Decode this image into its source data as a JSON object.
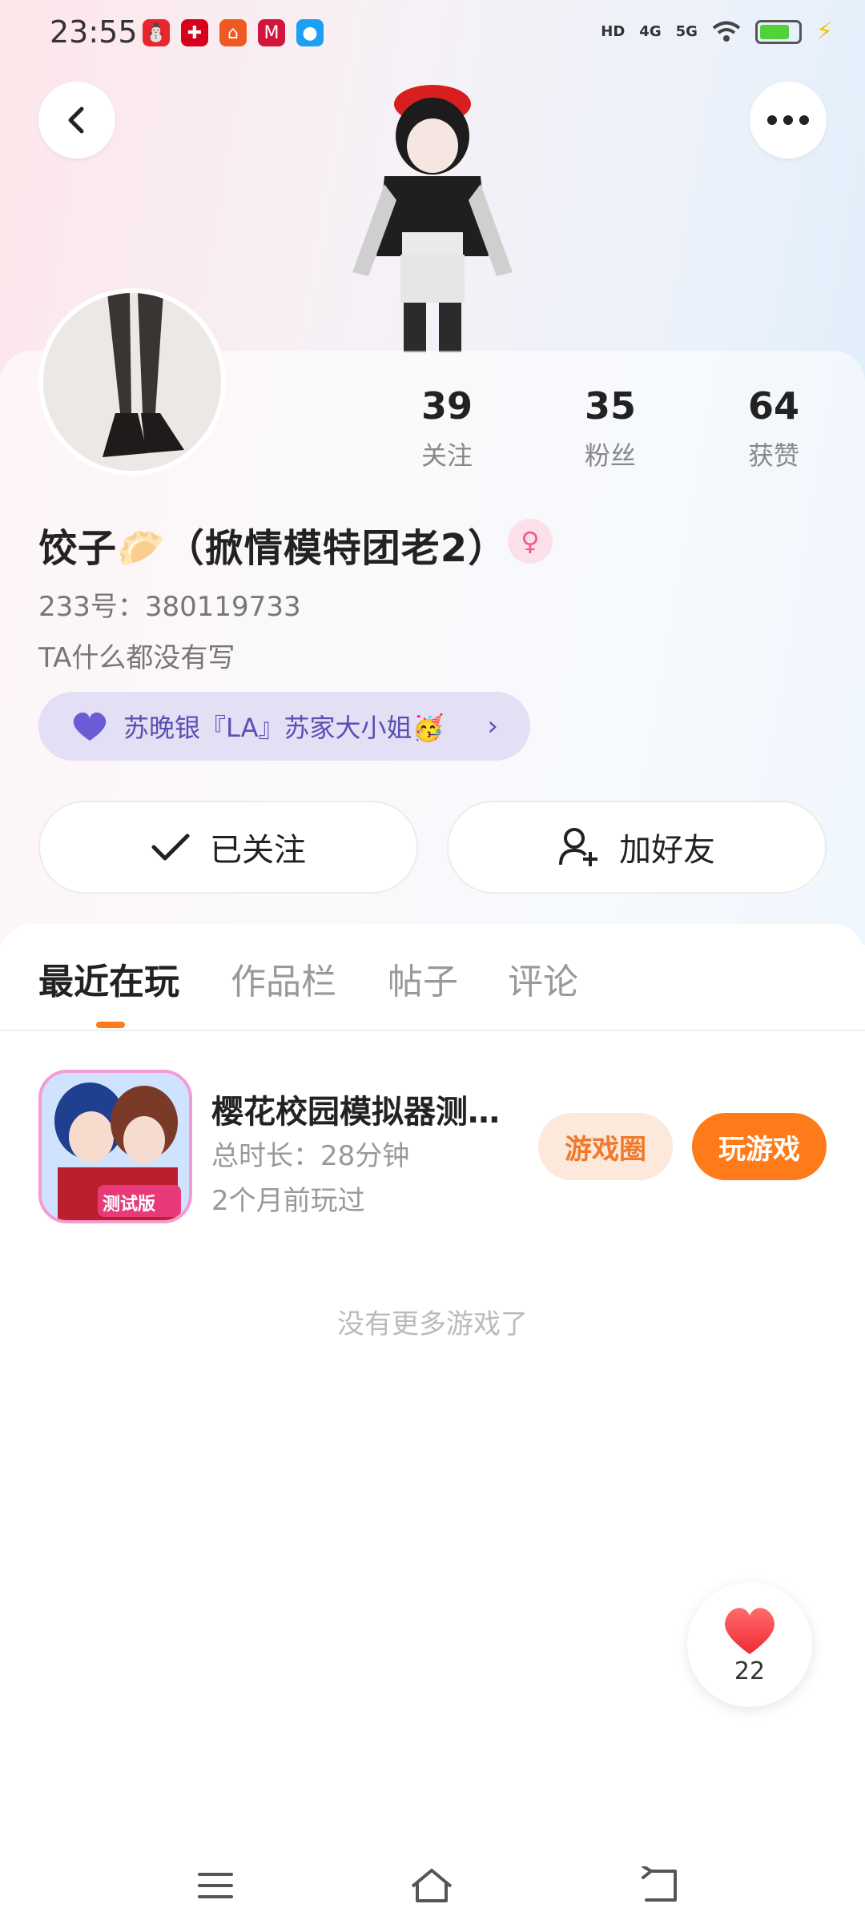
{
  "status_bar": {
    "time": "23:55",
    "network_labels": [
      "HD",
      "4G",
      "5G"
    ]
  },
  "profile": {
    "stats": [
      {
        "value": "39",
        "label": "关注"
      },
      {
        "value": "35",
        "label": "粉丝"
      },
      {
        "value": "64",
        "label": "获赞"
      }
    ],
    "name": "饺子🥟（掀情模特团老2）",
    "gender_symbol": "♀",
    "id_line": "233号：380119733",
    "bio": "TA什么都没有写",
    "guard_text": "苏晚银『LA』苏家大小姐🥳",
    "guard_chevron": "›"
  },
  "actions": {
    "follow_label": "已关注",
    "add_friend_label": "加好友"
  },
  "tabs": [
    "最近在玩",
    "作品栏",
    "帖子",
    "评论"
  ],
  "game": {
    "title": "樱花校园模拟器测…",
    "duration": "总时长：28分钟",
    "last_played": "2个月前玩过",
    "icon_badge": "测试版",
    "circle_button": "游戏圈",
    "play_button": "玩游戏"
  },
  "empty_text": "没有更多游戏了",
  "like": {
    "count": "22"
  },
  "colors": {
    "accent": "#ff7a19",
    "guard_pill": "#e3dff4",
    "guard_text": "#5a4fb3"
  }
}
